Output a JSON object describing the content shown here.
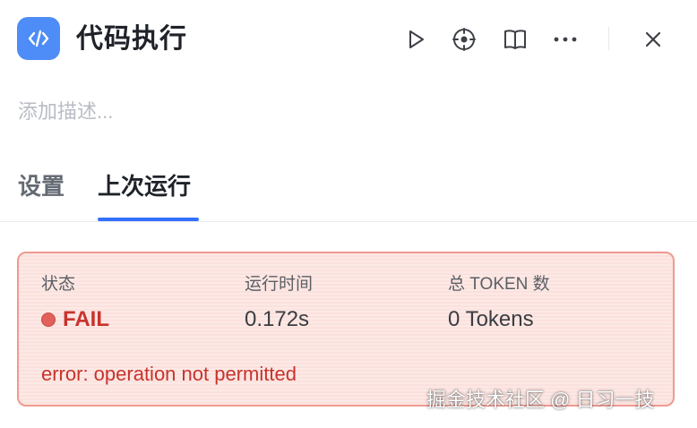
{
  "header": {
    "title": "代码执行",
    "app_icon": "code-icon",
    "actions": [
      "play-icon",
      "target-icon",
      "book-icon",
      "more-icon",
      "close-icon"
    ]
  },
  "description": {
    "placeholder": "添加描述..."
  },
  "tabs": [
    {
      "label": "设置",
      "active": false
    },
    {
      "label": "上次运行",
      "active": true
    }
  ],
  "run_result": {
    "status_label": "状态",
    "status_value": "FAIL",
    "time_label": "运行时间",
    "time_value": "0.172s",
    "tokens_label": "总 TOKEN 数",
    "tokens_value": "0 Tokens",
    "error": "error: operation not permitted"
  },
  "watermark": "掘金技术社区 @ 日习一技",
  "colors": {
    "accent": "#3370ff",
    "app_icon_bg": "#4e8cf7",
    "error_red": "#c8332c",
    "error_bg": "#fce9e6",
    "error_border": "#f09a90"
  }
}
